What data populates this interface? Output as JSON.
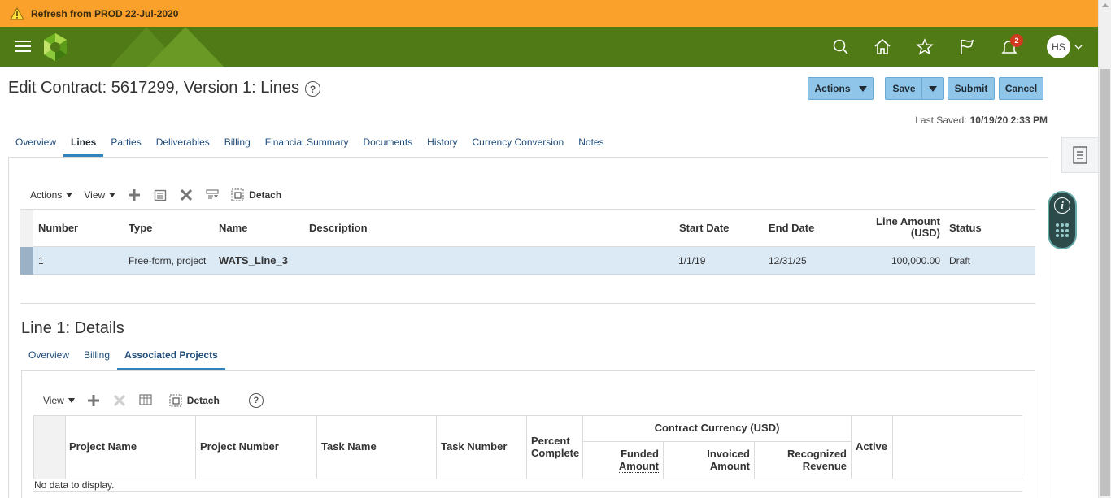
{
  "banner": {
    "text": "Refresh from PROD 22-Jul-2020"
  },
  "header": {
    "avatar_initials": "HS",
    "notification_count": "2"
  },
  "page": {
    "title": "Edit Contract: 5617299, Version 1: Lines",
    "help": "?",
    "buttons": {
      "actions": "Actions",
      "save": "Save",
      "submit_pre": "Sub",
      "submit_u": "m",
      "submit_post": "it",
      "cancel_u": "C",
      "cancel_post": "ancel"
    },
    "last_saved_label": "Last Saved:",
    "last_saved_value": "10/19/20 2:33 PM"
  },
  "tabs": [
    "Overview",
    "Lines",
    "Parties",
    "Deliverables",
    "Billing",
    "Financial Summary",
    "Documents",
    "History",
    "Currency Conversion",
    "Notes"
  ],
  "lines": {
    "toolbar": {
      "actions": "Actions",
      "view": "View",
      "detach": "Detach"
    },
    "headers": {
      "number": "Number",
      "type": "Type",
      "name": "Name",
      "description": "Description",
      "start_date": "Start Date",
      "end_date": "End Date",
      "line_amount_1": "Line Amount",
      "line_amount_2": "(USD)",
      "status": "Status"
    },
    "row": {
      "number": "1",
      "type": "Free-form, project",
      "name": "WATS_Line_3",
      "description": "",
      "start_date": "1/1/19",
      "end_date": "12/31/25",
      "line_amount": "100,000.00",
      "status": "Draft"
    }
  },
  "details": {
    "title": "Line 1: Details",
    "subtabs": [
      "Overview",
      "Billing",
      "Associated Projects"
    ],
    "toolbar": {
      "view": "View",
      "detach": "Detach",
      "help": "?"
    },
    "headers": {
      "project_name": "Project Name",
      "project_number": "Project Number",
      "task_name": "Task Name",
      "task_number": "Task Number",
      "percent_1": "Percent",
      "percent_2": "Complete",
      "contract_currency": "Contract Currency (USD)",
      "funded_1": "Funded",
      "funded_2": "Amount",
      "invoiced_1": "Invoiced",
      "invoiced_2": "Amount",
      "recognized_1": "Recognized",
      "recognized_2": "Revenue",
      "active": "Active"
    },
    "empty": "No data to display."
  }
}
